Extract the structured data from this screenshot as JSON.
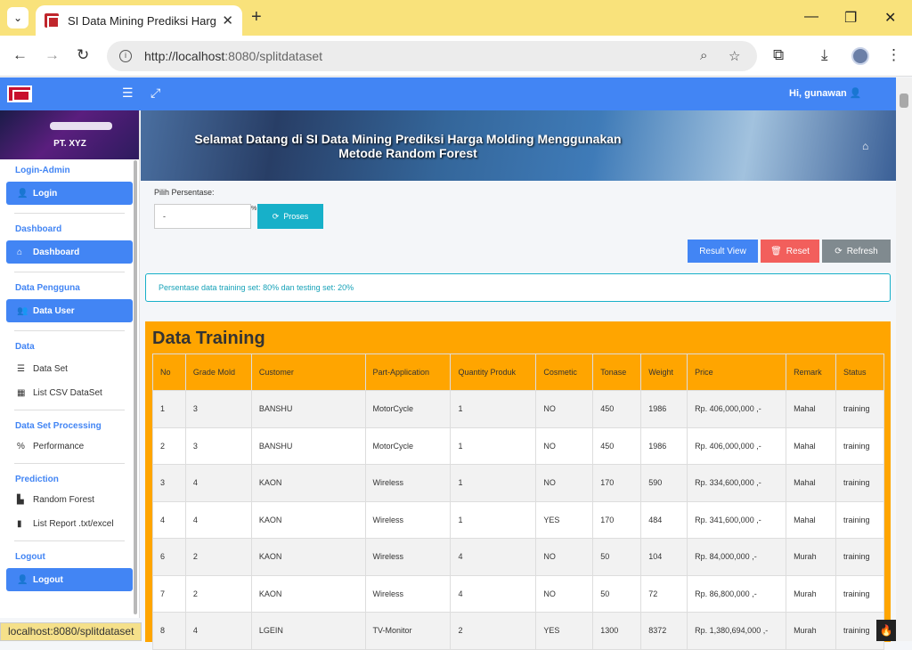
{
  "browser": {
    "tab_title": "SI Data Mining Prediksi Harga M",
    "url_host": "http://localhost",
    "url_rest": ":8080/splitdataset",
    "status_url": "localhost:8080/splitdataset"
  },
  "header": {
    "greeting": "Hi, gunawan"
  },
  "sidebar": {
    "company": "PT. XYZ",
    "sections": {
      "login": "Login-Admin",
      "dashboard": "Dashboard",
      "pengguna": "Data Pengguna",
      "data": "Data",
      "processing": "Data Set Processing",
      "prediction": "Prediction",
      "logout": "Logout"
    },
    "items": {
      "login": "Login",
      "dashboard": "Dashboard",
      "data_user": "Data User",
      "data_set": "Data Set",
      "list_csv": "List CSV DataSet",
      "performance": "Performance",
      "random_forest": "Random Forest",
      "list_report": "List Report .txt/excel",
      "logout": "Logout"
    }
  },
  "banner": {
    "line1": "Selamat Datang di SI Data Mining Prediksi Harga Molding Menggunakan",
    "line2": "Metode Random Forest"
  },
  "form": {
    "label": "Pilih Persentase:",
    "value": "-",
    "pct": "%",
    "proses": "Proses"
  },
  "actions": {
    "result_view": "Result View",
    "reset": "Reset",
    "refresh": "Refresh"
  },
  "alert": "Persentase data training set: 80% dan testing set: 20%",
  "training": {
    "title": "Data Training",
    "columns": [
      "No",
      "Grade Mold",
      "Customer",
      "Part-Application",
      "Quantity Produk",
      "Cosmetic",
      "Tonase",
      "Weight",
      "Price",
      "Remark",
      "Status"
    ],
    "rows": [
      [
        "1",
        "3",
        "BANSHU",
        "MotorCycle",
        "1",
        "NO",
        "450",
        "1986",
        "Rp. 406,000,000 ,-",
        "Mahal",
        "training"
      ],
      [
        "2",
        "3",
        "BANSHU",
        "MotorCycle",
        "1",
        "NO",
        "450",
        "1986",
        "Rp. 406,000,000 ,-",
        "Mahal",
        "training"
      ],
      [
        "3",
        "4",
        "KAON",
        "Wireless",
        "1",
        "NO",
        "170",
        "590",
        "Rp. 334,600,000 ,-",
        "Mahal",
        "training"
      ],
      [
        "4",
        "4",
        "KAON",
        "Wireless",
        "1",
        "YES",
        "170",
        "484",
        "Rp. 341,600,000 ,-",
        "Mahal",
        "training"
      ],
      [
        "6",
        "2",
        "KAON",
        "Wireless",
        "4",
        "NO",
        "50",
        "104",
        "Rp. 84,000,000 ,-",
        "Murah",
        "training"
      ],
      [
        "7",
        "2",
        "KAON",
        "Wireless",
        "4",
        "NO",
        "50",
        "72",
        "Rp. 86,800,000 ,-",
        "Murah",
        "training"
      ],
      [
        "8",
        "4",
        "LGEIN",
        "TV-Monitor",
        "2",
        "YES",
        "1300",
        "8372",
        "Rp. 1,380,694,000 ,-",
        "Murah",
        "training"
      ]
    ]
  }
}
